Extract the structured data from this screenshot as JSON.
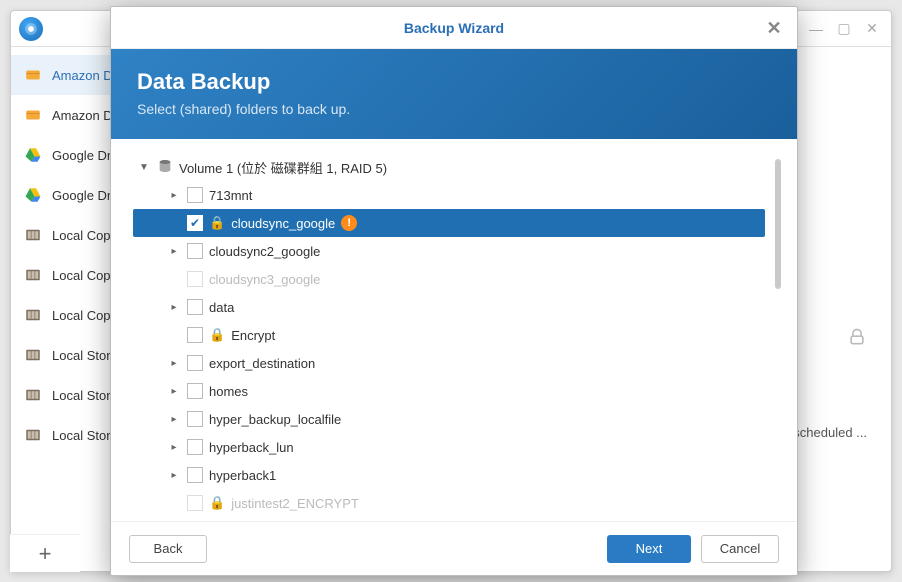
{
  "bg_window": {
    "minimize": "—",
    "maximize": "▢",
    "close": "✕"
  },
  "sidebar": {
    "items": [
      {
        "label": "Amazon Drive",
        "icon": "amazon"
      },
      {
        "label": "Amazon Drive",
        "icon": "amazon"
      },
      {
        "label": "Google Drive",
        "icon": "drive"
      },
      {
        "label": "Google Drive test",
        "icon": "drive"
      },
      {
        "label": "Local Copy",
        "icon": "local"
      },
      {
        "label": "Local Copy",
        "icon": "local"
      },
      {
        "label": "Local Copy",
        "icon": "local"
      },
      {
        "label": "Local Storage",
        "icon": "local"
      },
      {
        "label": "Local Storage",
        "icon": "local"
      },
      {
        "label": "Local Storage",
        "icon": "local"
      }
    ],
    "add": "+"
  },
  "bg_right": {
    "scheduled": "scheduled ..."
  },
  "dialog": {
    "title": "Backup Wizard",
    "close": "✕",
    "banner_title": "Data Backup",
    "banner_subtitle": "Select (shared) folders to back up.",
    "buttons": {
      "back": "Back",
      "next": "Next",
      "cancel": "Cancel"
    }
  },
  "tree": {
    "volume_label": "Volume 1 (位於 磁碟群組 1, RAID 5)",
    "folders": [
      {
        "name": "713mnt",
        "expandable": true,
        "checked": false,
        "locked": false,
        "warn": false,
        "selected": false,
        "disabled": false
      },
      {
        "name": "cloudsync_google",
        "expandable": false,
        "checked": true,
        "locked": true,
        "warn": true,
        "selected": true,
        "disabled": false
      },
      {
        "name": "cloudsync2_google",
        "expandable": true,
        "checked": false,
        "locked": false,
        "warn": false,
        "selected": false,
        "disabled": false
      },
      {
        "name": "cloudsync3_google",
        "expandable": false,
        "checked": false,
        "locked": false,
        "warn": false,
        "selected": false,
        "disabled": true
      },
      {
        "name": "data",
        "expandable": true,
        "checked": false,
        "locked": false,
        "warn": false,
        "selected": false,
        "disabled": false
      },
      {
        "name": "Encrypt",
        "expandable": false,
        "checked": false,
        "locked": true,
        "warn": false,
        "selected": false,
        "disabled": false
      },
      {
        "name": "export_destination",
        "expandable": true,
        "checked": false,
        "locked": false,
        "warn": false,
        "selected": false,
        "disabled": false
      },
      {
        "name": "homes",
        "expandable": true,
        "checked": false,
        "locked": false,
        "warn": false,
        "selected": false,
        "disabled": false
      },
      {
        "name": "hyper_backup_localfile",
        "expandable": true,
        "checked": false,
        "locked": false,
        "warn": false,
        "selected": false,
        "disabled": false
      },
      {
        "name": "hyperback_lun",
        "expandable": true,
        "checked": false,
        "locked": false,
        "warn": false,
        "selected": false,
        "disabled": false
      },
      {
        "name": "hyperback1",
        "expandable": true,
        "checked": false,
        "locked": false,
        "warn": false,
        "selected": false,
        "disabled": false
      },
      {
        "name": "justintest2_ENCRYPT",
        "expandable": false,
        "checked": false,
        "locked": true,
        "warn": false,
        "selected": false,
        "disabled": true
      }
    ]
  }
}
